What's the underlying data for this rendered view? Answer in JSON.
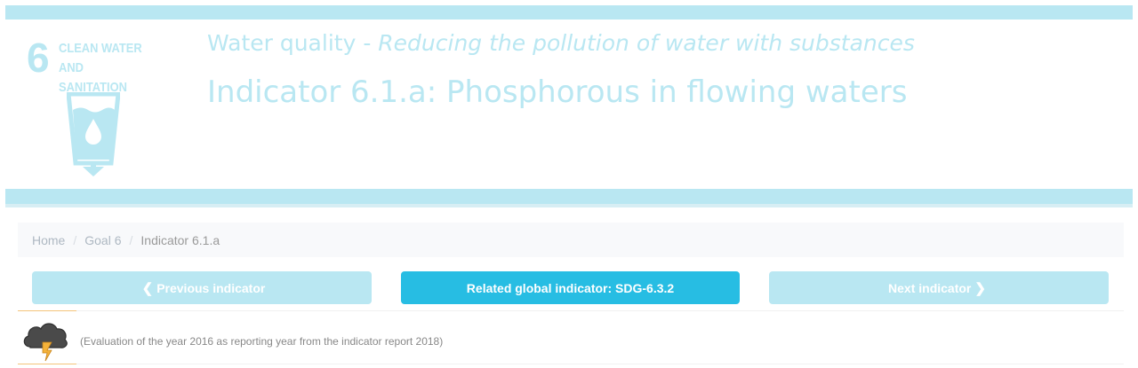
{
  "goal": {
    "number": "6",
    "name": "CLEAN WATER AND SANITATION",
    "icon": "water-glass-icon"
  },
  "header": {
    "subtitle_prefix": "Water quality - ",
    "subtitle_emphasis": "Reducing the pollution of water with substances",
    "title": "Indicator 6.1.a: Phosphorous in flowing waters"
  },
  "breadcrumb": {
    "items": [
      "Home",
      "Goal 6"
    ],
    "separator": "/",
    "current": "Indicator 6.1.a"
  },
  "buttons": {
    "previous": "Previous indicator",
    "related": "Related global indicator: SDG-6.3.2",
    "next": "Next indicator"
  },
  "evaluation": {
    "icon": "thunderstorm-icon",
    "text": "(Evaluation of the year 2016 as reporting year from the indicator report 2018)"
  },
  "colors": {
    "light_blue": "#b9e7f2",
    "accent_blue": "#27bde3",
    "orange_accent": "#f3c47a"
  }
}
